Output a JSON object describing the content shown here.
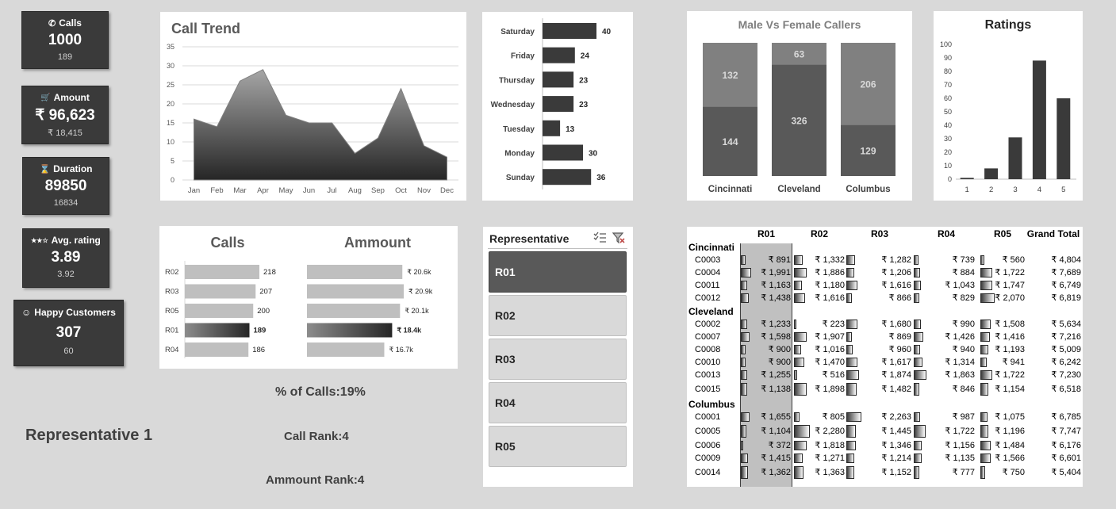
{
  "kpis": {
    "calls": {
      "icon": "phone-icon",
      "title": "Calls",
      "value": "1000",
      "sub": "189"
    },
    "amount": {
      "icon": "cart-icon",
      "title": "Amount",
      "value": "₹ 96,623",
      "sub": "₹ 18,415"
    },
    "duration": {
      "icon": "hourglass-icon",
      "title": "Duration",
      "value": "89850",
      "sub": "16834"
    },
    "rating": {
      "icon": "stars-icon",
      "title": "Avg. rating",
      "value": "3.89",
      "sub": "3.92"
    },
    "happy": {
      "icon": "smiley-icon",
      "title": "Happy Customers",
      "value": "307",
      "sub": "60"
    }
  },
  "labels": {
    "rep_name": "Representative 1",
    "pct_calls": "% of Calls:19%",
    "call_rank": "Call Rank:4",
    "amount_rank": "Ammount Rank:4"
  },
  "slicer": {
    "title": "Representative",
    "items": [
      "R01",
      "R02",
      "R03",
      "R04",
      "R05"
    ],
    "selected": "R01"
  },
  "chart_data": [
    {
      "id": "call-trend",
      "type": "area",
      "title": "Call Trend",
      "categories": [
        "Jan",
        "Feb",
        "Mar",
        "Apr",
        "May",
        "Jun",
        "Jul",
        "Aug",
        "Sep",
        "Oct",
        "Nov",
        "Dec"
      ],
      "values": [
        16,
        14,
        26,
        29,
        17,
        15,
        15,
        7,
        11,
        24,
        9,
        6
      ],
      "ylim": [
        0,
        35
      ],
      "yticks": [
        0,
        5,
        10,
        15,
        20,
        25,
        30,
        35
      ],
      "grid": true
    },
    {
      "id": "weekday-calls",
      "type": "bar",
      "orientation": "horizontal",
      "title": "",
      "categories": [
        "Saturday",
        "Friday",
        "Thursday",
        "Wednesday",
        "Tuesday",
        "Monday",
        "Sunday"
      ],
      "values": [
        40,
        24,
        23,
        23,
        13,
        30,
        36
      ]
    },
    {
      "id": "gender-callers",
      "type": "bar",
      "stacked": true,
      "title": "Male Vs Female  Callers",
      "categories": [
        "Cincinnati",
        "Cleveland",
        "Columbus"
      ],
      "series": [
        {
          "values": [
            144,
            326,
            129
          ],
          "color": "#595959"
        },
        {
          "values": [
            132,
            63,
            206
          ],
          "color": "#808080"
        }
      ]
    },
    {
      "id": "ratings",
      "type": "bar",
      "title": "Ratings",
      "categories": [
        "1",
        "2",
        "3",
        "4",
        "5"
      ],
      "values": [
        1,
        8,
        31,
        88,
        60
      ],
      "ylim": [
        0,
        100
      ],
      "yticks": [
        0,
        10,
        20,
        30,
        40,
        50,
        60,
        70,
        80,
        90,
        100
      ]
    },
    {
      "id": "rep-calls",
      "type": "bar",
      "orientation": "horizontal",
      "title": "Calls",
      "categories": [
        "R02",
        "R03",
        "R05",
        "R01",
        "R04"
      ],
      "values": [
        218,
        207,
        200,
        189,
        186
      ],
      "data_labels": [
        "218",
        "207",
        "200",
        "189",
        "186"
      ],
      "highlight": "R01"
    },
    {
      "id": "rep-amount",
      "type": "bar",
      "orientation": "horizontal",
      "title": "Ammount",
      "categories": [
        "R02",
        "R03",
        "R05",
        "R01",
        "R04"
      ],
      "values": [
        20600,
        20900,
        20100,
        18400,
        16700
      ],
      "data_labels": [
        "₹ 20.6k",
        "₹ 20.9k",
        "₹ 20.1k",
        "₹ 18.4k",
        "₹ 16.7k"
      ],
      "highlight": "R01"
    },
    {
      "id": "pivot-table",
      "type": "table",
      "columns": [
        "R01",
        "R02",
        "R03",
        "R04",
        "R05",
        "Grand Total"
      ],
      "groups": [
        {
          "name": "Cincinnati",
          "rows": [
            {
              "id": "C0003",
              "values": [
                891,
                1332,
                1282,
                739,
                560
              ],
              "labels": [
                "₹ 891",
                "₹ 1,332",
                "₹ 1,282",
                "₹ 739",
                "₹ 560"
              ],
              "total": "₹ 4,804"
            },
            {
              "id": "C0004",
              "values": [
                1991,
                1886,
                1206,
                884,
                1722
              ],
              "labels": [
                "₹ 1,991",
                "₹ 1,886",
                "₹ 1,206",
                "₹ 884",
                "₹ 1,722"
              ],
              "total": "₹ 7,689"
            },
            {
              "id": "C0011",
              "values": [
                1163,
                1180,
                1616,
                1043,
                1747
              ],
              "labels": [
                "₹ 1,163",
                "₹ 1,180",
                "₹ 1,616",
                "₹ 1,043",
                "₹ 1,747"
              ],
              "total": "₹ 6,749"
            },
            {
              "id": "C0012",
              "values": [
                1438,
                1616,
                866,
                829,
                2070
              ],
              "labels": [
                "₹ 1,438",
                "₹ 1,616",
                "₹ 866",
                "₹ 829",
                "₹ 2,070"
              ],
              "total": "₹ 6,819"
            }
          ]
        },
        {
          "name": "Cleveland",
          "rows": [
            {
              "id": "C0002",
              "values": [
                1233,
                223,
                1680,
                990,
                1508
              ],
              "labels": [
                "₹ 1,233",
                "₹ 223",
                "₹ 1,680",
                "₹ 990",
                "₹ 1,508"
              ],
              "total": "₹ 5,634"
            },
            {
              "id": "C0007",
              "values": [
                1598,
                1907,
                869,
                1426,
                1416
              ],
              "labels": [
                "₹ 1,598",
                "₹ 1,907",
                "₹ 869",
                "₹ 1,426",
                "₹ 1,416"
              ],
              "total": "₹ 7,216"
            },
            {
              "id": "C0008",
              "values": [
                900,
                1016,
                960,
                940,
                1193
              ],
              "labels": [
                "₹ 900",
                "₹ 1,016",
                "₹ 960",
                "₹ 940",
                "₹ 1,193"
              ],
              "total": "₹ 5,009"
            },
            {
              "id": "C0010",
              "values": [
                900,
                1470,
                1617,
                1314,
                941
              ],
              "labels": [
                "₹ 900",
                "₹ 1,470",
                "₹ 1,617",
                "₹ 1,314",
                "₹ 941"
              ],
              "total": "₹ 6,242"
            },
            {
              "id": "C0013",
              "values": [
                1255,
                516,
                1874,
                1863,
                1722
              ],
              "labels": [
                "₹ 1,255",
                "₹ 516",
                "₹ 1,874",
                "₹ 1,863",
                "₹ 1,722"
              ],
              "total": "₹ 7,230"
            },
            {
              "id": "C0015",
              "values": [
                1138,
                1898,
                1482,
                846,
                1154
              ],
              "labels": [
                "₹ 1,138",
                "₹ 1,898",
                "₹ 1,482",
                "₹ 846",
                "₹ 1,154"
              ],
              "total": "₹ 6,518"
            }
          ]
        },
        {
          "name": "Columbus",
          "rows": [
            {
              "id": "C0001",
              "values": [
                1655,
                805,
                2263,
                987,
                1075
              ],
              "labels": [
                "₹ 1,655",
                "₹ 805",
                "₹ 2,263",
                "₹ 987",
                "₹ 1,075"
              ],
              "total": "₹ 6,785"
            },
            {
              "id": "C0005",
              "values": [
                1104,
                2280,
                1445,
                1722,
                1196
              ],
              "labels": [
                "₹ 1,104",
                "₹ 2,280",
                "₹ 1,445",
                "₹ 1,722",
                "₹ 1,196"
              ],
              "total": "₹ 7,747"
            },
            {
              "id": "C0006",
              "values": [
                372,
                1818,
                1346,
                1156,
                1484
              ],
              "labels": [
                "₹ 372",
                "₹ 1,818",
                "₹ 1,346",
                "₹ 1,156",
                "₹ 1,484"
              ],
              "total": "₹ 6,176"
            },
            {
              "id": "C0009",
              "values": [
                1415,
                1271,
                1214,
                1135,
                1566
              ],
              "labels": [
                "₹ 1,415",
                "₹ 1,271",
                "₹ 1,214",
                "₹ 1,135",
                "₹ 1,566"
              ],
              "total": "₹ 6,601"
            },
            {
              "id": "C0014",
              "values": [
                1362,
                1363,
                1152,
                777,
                750
              ],
              "labels": [
                "₹ 1,362",
                "₹ 1,363",
                "₹ 1,152",
                "₹ 777",
                "₹ 750"
              ],
              "total": "₹ 5,404"
            }
          ]
        }
      ]
    }
  ]
}
